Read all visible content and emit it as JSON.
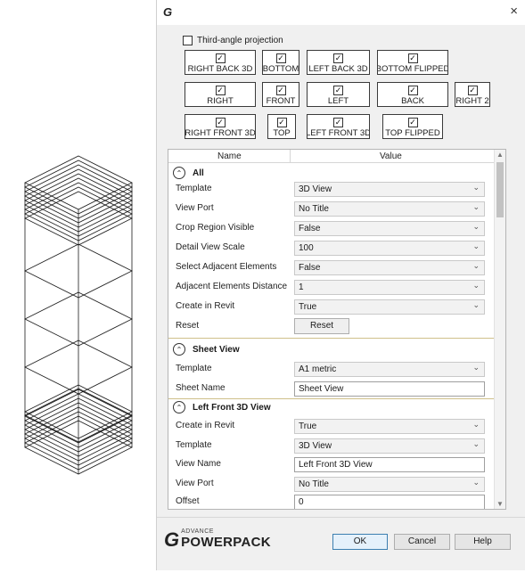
{
  "dialog": {
    "logo_glyph": "G",
    "close_glyph": "×"
  },
  "projection": {
    "third_angle_label": "Third-angle projection",
    "third_angle_checked": false
  },
  "view_buttons": {
    "right_back_3d": {
      "label": "RIGHT BACK 3D",
      "checked": true
    },
    "bottom": {
      "label": "BOTTOM",
      "checked": true
    },
    "left_back_3d": {
      "label": "LEFT BACK 3D",
      "checked": true
    },
    "bottom_flipped": {
      "label": "BOTTOM FLIPPED",
      "checked": true
    },
    "right": {
      "label": "RIGHT",
      "checked": true
    },
    "front": {
      "label": "FRONT",
      "checked": true
    },
    "left": {
      "label": "LEFT",
      "checked": true
    },
    "back": {
      "label": "BACK",
      "checked": true
    },
    "right_2": {
      "label": "RIGHT 2",
      "checked": true
    },
    "right_front_3d": {
      "label": "RIGHT FRONT 3D",
      "checked": true
    },
    "top": {
      "label": "TOP",
      "checked": true
    },
    "left_front_3d": {
      "label": "LEFT FRONT 3D",
      "checked": true
    },
    "top_flipped": {
      "label": "TOP FLIPPED",
      "checked": true
    }
  },
  "grid": {
    "col_name": "Name",
    "col_value": "Value",
    "sections": {
      "all": {
        "title": "All",
        "rows": {
          "template": {
            "name": "Template",
            "value": "3D View"
          },
          "view_port": {
            "name": "View Port",
            "value": "No Title"
          },
          "crop_region_visible": {
            "name": "Crop Region Visible",
            "value": "False"
          },
          "detail_view_scale": {
            "name": "Detail View Scale",
            "value": "100"
          },
          "select_adjacent": {
            "name": "Select Adjacent Elements",
            "value": "False"
          },
          "adjacent_distance": {
            "name": "Adjacent Elements Distance",
            "value": "1"
          },
          "create_in_revit": {
            "name": "Create in Revit",
            "value": "True"
          },
          "reset": {
            "name": "Reset",
            "button": "Reset"
          }
        }
      },
      "sheet_view": {
        "title": "Sheet View",
        "rows": {
          "template": {
            "name": "Template",
            "value": "A1 metric"
          },
          "sheet_name": {
            "name": "Sheet Name",
            "value": "Sheet View"
          }
        }
      },
      "left_front_3d": {
        "title": "Left Front 3D View",
        "rows": {
          "create_in_revit": {
            "name": "Create in Revit",
            "value": "True"
          },
          "template": {
            "name": "Template",
            "value": "3D View"
          },
          "view_name": {
            "name": "View Name",
            "value": "Left Front 3D View"
          },
          "view_port": {
            "name": "View Port",
            "value": "No Title"
          },
          "offset": {
            "name": "Offset",
            "value": "0"
          }
        }
      }
    }
  },
  "footer": {
    "brand_glyph": "G",
    "brand_small": "ADVANCE",
    "brand_name": "POWERPACK",
    "ok_label": "OK",
    "cancel_label": "Cancel",
    "help_label": "Help"
  },
  "icons": {
    "collapse": "collapse-chevron-up-icon",
    "dropdown": "chevron-down-icon",
    "check": "checkmark-icon"
  }
}
